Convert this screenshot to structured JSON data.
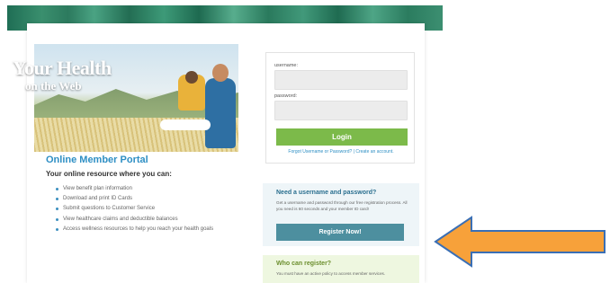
{
  "hero": {
    "title": "Your Health",
    "subtitle": "on the Web"
  },
  "portal": {
    "title": "Online Member Portal",
    "subtitle": "Your online resource where you can:",
    "features": [
      "View benefit plan information",
      "Download and print ID Cards",
      "Submit questions to Customer Service",
      "View healthcare claims and deductible balances",
      "Access wellness resources to help you reach your health goals"
    ]
  },
  "login": {
    "username_label": "username:",
    "username_value": "",
    "password_label": "password:",
    "password_value": "",
    "button_label": "Login",
    "forgot_link": "Forgot Username or Password?",
    "separator": " | ",
    "create_link": "Create an account."
  },
  "register": {
    "title": "Need a username and password?",
    "text": "Get a username and password through our free registration process. All you need is 60 seconds and your member ID card!",
    "button_label": "Register Now!"
  },
  "who": {
    "title": "Who can register?",
    "text": "You must have an active policy to access member services."
  },
  "colors": {
    "banner": "#2c7a5e",
    "accent_blue": "#2e8fc4",
    "login_green": "#7cba4a",
    "register_teal": "#4d8f9f",
    "arrow_orange": "#f7a13a"
  },
  "icons": {
    "annotation": "arrow-left-icon"
  }
}
